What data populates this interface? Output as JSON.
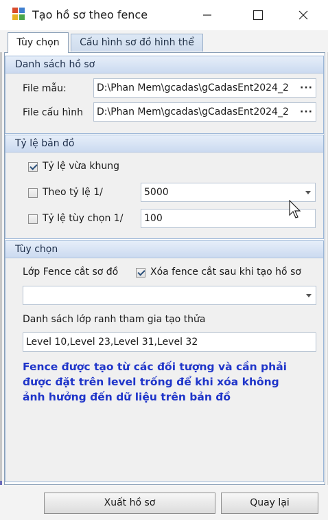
{
  "window": {
    "title": "Tạo hồ sơ theo fence"
  },
  "tabs": [
    {
      "label": "Tùy chọn",
      "active": true
    },
    {
      "label": "Cấu hình sơ đồ hình thể",
      "active": false
    }
  ],
  "group_files": {
    "title": "Danh sách hồ sơ",
    "template_label": "File mẫu:",
    "template_value": "D:\\Phan Mem\\gcadas\\gCadasEnt2024_2",
    "config_label": "File cấu hình",
    "config_value": "D:\\Phan Mem\\gcadas\\gCadasEnt2024_2",
    "browse_label": "···"
  },
  "group_scale": {
    "title": "Tỷ lệ bản đồ",
    "fit_frame_label": "Tỷ lệ vừa khung",
    "fit_frame_checked": true,
    "by_scale_label": "Theo tỷ lệ 1/",
    "by_scale_checked": false,
    "by_scale_value": "5000",
    "custom_label": "Tỷ lệ tùy chọn 1/",
    "custom_checked": false,
    "custom_value": "100"
  },
  "group_options": {
    "title": "Tùy chọn",
    "fence_layer_label": "Lớp Fence cắt sơ đồ",
    "delete_fence_label": "Xóa fence cắt sau khi tạo hồ sơ",
    "delete_fence_checked": true,
    "fence_layer_value": "",
    "boundary_layers_label": "Danh sách lớp ranh tham gia tạo thửa",
    "boundary_layers_value": "Level 10,Level 23,Level 31,Level 32",
    "note": "Fence được tạo từ các đối tượng và cần phải\n được đặt trên level trống để khi xóa không\nảnh hưởng đến dữ liệu trên bản đồ",
    "note_color": "#1f35c9"
  },
  "buttons": {
    "export": "Xuất hồ sơ",
    "back": "Quay lại"
  }
}
